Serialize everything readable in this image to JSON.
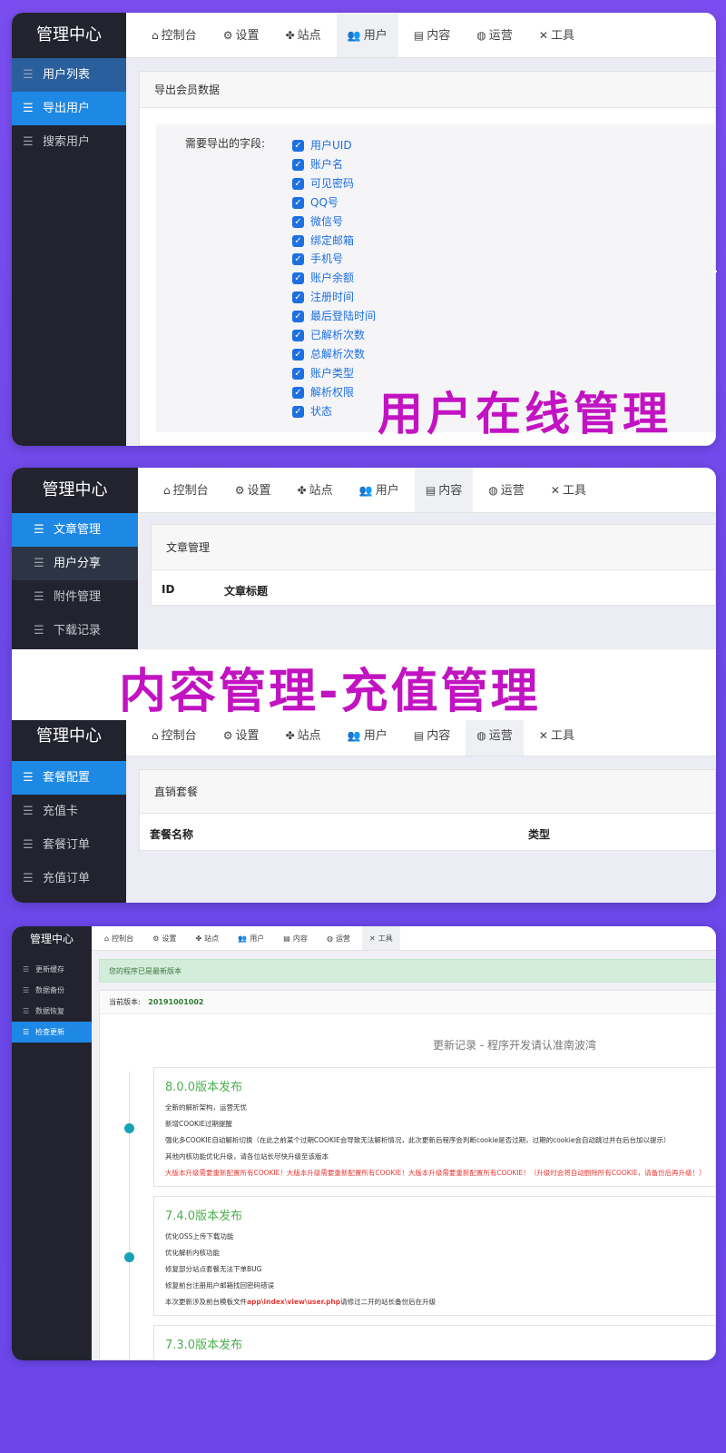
{
  "sidebar_title": "管理中心",
  "tabs": {
    "dashboard": "控制台",
    "settings": "设置",
    "site": "站点",
    "user": "用户",
    "content": "内容",
    "operations": "运营",
    "tools": "工具"
  },
  "panel1": {
    "sidebar": [
      "用户列表",
      "导出用户",
      "搜索用户"
    ],
    "panel_title": "导出会员数据",
    "fields_label": "需要导出的字段:",
    "fields": [
      "用户UID",
      "账户名",
      "可见密码",
      "QQ号",
      "微信号",
      "绑定邮箱",
      "手机号",
      "账户余额",
      "注册时间",
      "最后登陆时间",
      "已解析次数",
      "总解析次数",
      "账户类型",
      "解析权限",
      "状态"
    ],
    "overlay": "用户在线管理"
  },
  "panel2": {
    "sidebar": [
      "文章管理",
      "用户分享",
      "附件管理",
      "下载记录"
    ],
    "panel_title": "文章管理",
    "columns": [
      "ID",
      "文章标题"
    ]
  },
  "overlay_mid": "内容管理-充值管理",
  "panel3": {
    "sidebar": [
      "套餐配置",
      "充值卡",
      "套餐订单",
      "充值订单"
    ],
    "panel_title": "直销套餐",
    "columns": [
      "套餐名称",
      "类型"
    ]
  },
  "panel4": {
    "sidebar": [
      "更新缓存",
      "数据备份",
      "数据恢复",
      "检查更新"
    ],
    "notice": "您的程序已是最新版本",
    "version_label": "当前版本:",
    "version_value": "20191001002",
    "changelog_title": "更新记录 - 程序开发请认准南波湾",
    "releases": [
      {
        "title": "8.0.0版本发布",
        "lines": [
          "全新的解析架构，运营无忧",
          "新增COOKIE过期提醒",
          "强化多COOKIE自动解析切换（在此之前某个过期COOKIE会导致无法解析情况，此次更新后程序会判断cookie是否过期，过期的cookie会自动跳过并在后台加以提示）",
          "其他内核功能优化升级，请各位站长尽快升级至该版本"
        ],
        "warning": "大版本升级需要重新配置所有COOKIE！大版本升级需要重新配置所有COOKIE！大版本升级需要重新配置所有COOKIE！（升级时会将自动删除所有COOKIE，请备份后再升级！）"
      },
      {
        "title": "7.4.0版本发布",
        "lines": [
          "优化OSS上传下载功能",
          "优化解析内核功能",
          "修复部分站点套餐无法下单BUG",
          "修复前台注册用户邮箱找回密码错误"
        ],
        "note_prefix": "本次更新涉及前台模板文件",
        "note_path": "app\\index\\view\\user.php",
        "note_suffix": "请修过二开的站长备份后在升级"
      },
      {
        "title": "7.3.0版本发布",
        "lines": []
      }
    ]
  },
  "colors": {
    "accent": "#1e88e5",
    "sidebar_bg": "#22232f",
    "overlay_text": "#c213c2",
    "background": "#7350ee"
  }
}
